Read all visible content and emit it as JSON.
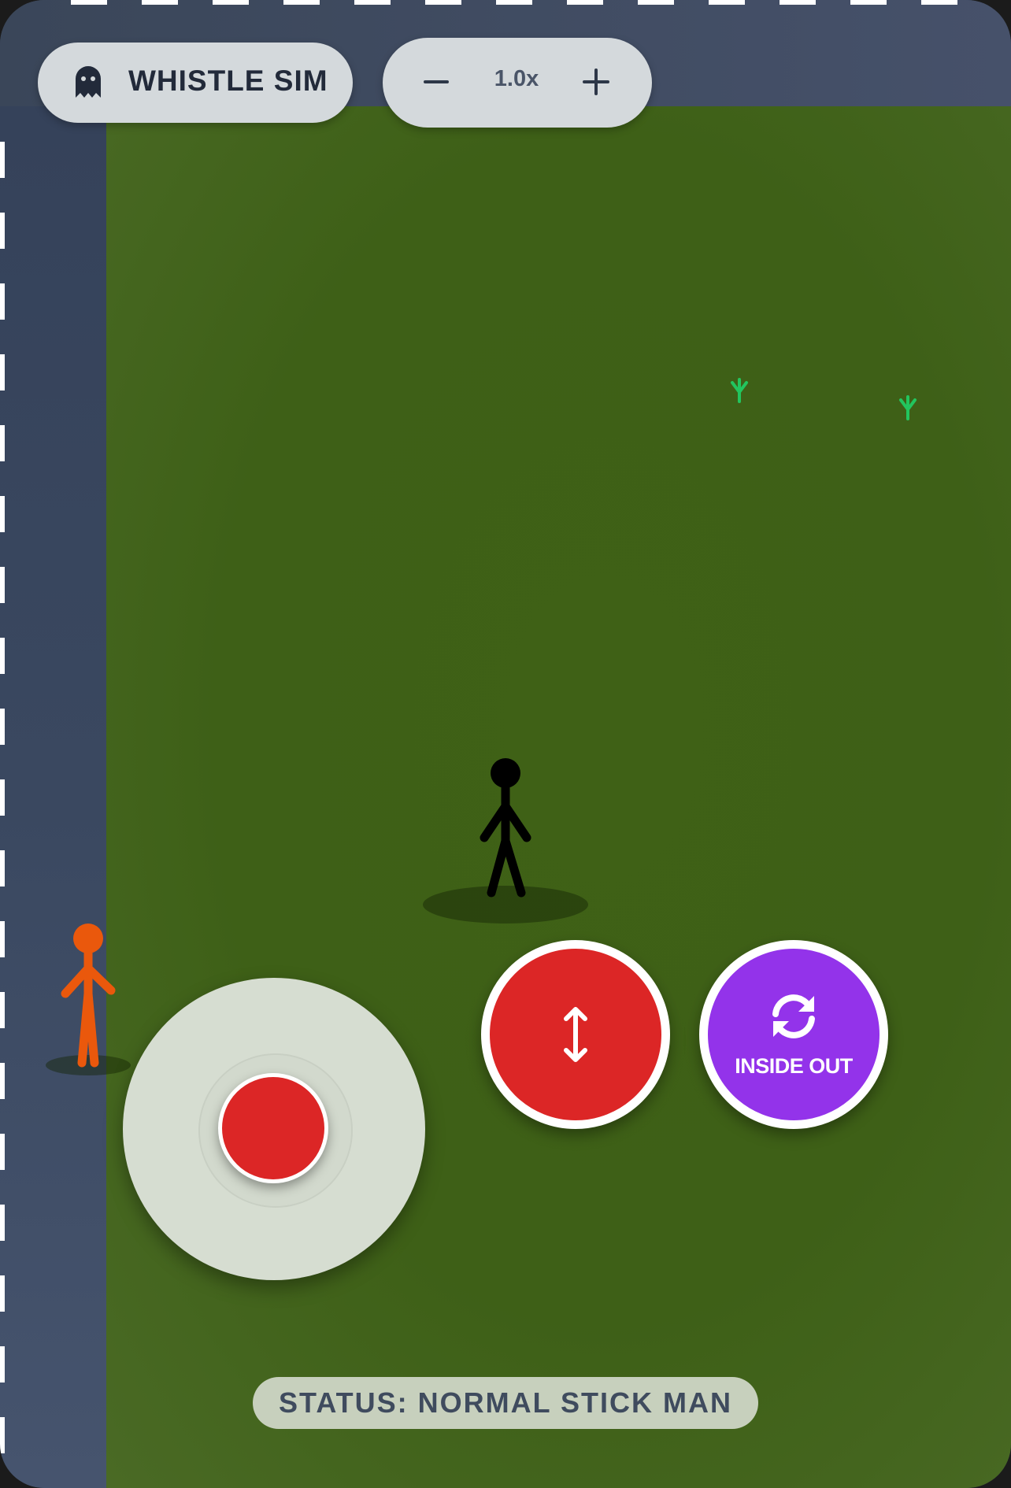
{
  "header": {
    "title": "WHISTLE SIM",
    "title_icon": "ghost-icon"
  },
  "zoom": {
    "value": "1.0x",
    "decrease_icon": "minus-icon",
    "increase_icon": "plus-icon"
  },
  "controls": {
    "resize_button_icon": "vertical-arrows-icon",
    "inside_out_button_icon": "refresh-icon",
    "inside_out_label": "INSIDE OUT"
  },
  "status": {
    "text": "STATUS: NORMAL STICK MAN"
  },
  "colors": {
    "grass": "#3e6017",
    "road": "#384559",
    "player": "#000000",
    "npc": "#ea580c",
    "resize_button": "#dc2626",
    "inside_out_button": "#9333ea",
    "sprout": "#22c55e"
  }
}
